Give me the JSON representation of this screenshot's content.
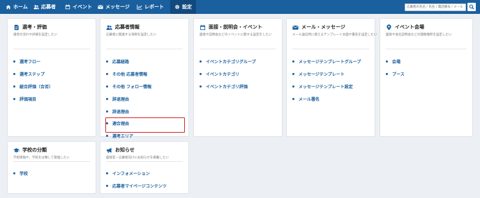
{
  "nav": {
    "items": [
      {
        "label": "ホーム",
        "icon": "home-icon"
      },
      {
        "label": "応募者",
        "icon": "users-icon"
      },
      {
        "label": "イベント",
        "icon": "calendar-icon"
      },
      {
        "label": "メッセージ",
        "icon": "mail-icon"
      },
      {
        "label": "レポート",
        "icon": "chart-icon"
      },
      {
        "label": "設定",
        "icon": "gear-icon",
        "active": true
      }
    ],
    "search_placeholder": "応募者の氏名 / 氏名 / 電話番号 / メール"
  },
  "cards": [
    {
      "title": "選考・評価",
      "icon": "document-icon",
      "description": "選考の流れや評価を設定したい",
      "links": [
        "選考フロー",
        "選考ステップ",
        "総合評価（合否）",
        "評価項目"
      ]
    },
    {
      "title": "応募者情報",
      "icon": "users-icon",
      "description": "応募者に関連する項目を設定したい",
      "links": [
        "応募経路",
        "その他 応募者情報",
        "その他 フォロー情報",
        "辞退理由",
        "辞退理由",
        "適合理由",
        "選考エリア"
      ]
    },
    {
      "title": "面接・説明会・イベント",
      "icon": "calendar-icon",
      "description": "面接や説明会などのイベントに関する設定をしたい",
      "links": [
        "イベントカテゴリグループ",
        "イベントカテゴリ",
        "イベントカテゴリ評価"
      ]
    },
    {
      "title": "メール・メッセージ",
      "icon": "mail-icon",
      "description": "メール送信時に使えるテンプレート文面や署名を設定したい",
      "links": [
        "メッセージテンプレートグループ",
        "メッセージテンプレート",
        "メッセージテンプレート設定",
        "メール署名"
      ]
    },
    {
      "title": "イベント会場",
      "icon": "map-marker-icon",
      "description": "面接や会社説明会などの開催場所を設定したい",
      "links": [
        "会場",
        "ブース"
      ]
    },
    {
      "title": "学校の分類",
      "icon": "graduation-icon",
      "description": "学校情報や、学校を分類して管理したい",
      "links": [
        "学校"
      ]
    },
    {
      "title": "お知らせ",
      "icon": "megaphone-icon",
      "description": "面接官・応募者向けにお知らせを掲載したい",
      "links": [
        "インフォメーション",
        "応募者マイページコンテンツ"
      ]
    }
  ],
  "highlighted_link": "選考エリア",
  "colors": {
    "nav_bg": "#1a5f9e",
    "nav_active_bg": "#124a7e",
    "link": "#1a5f9e",
    "highlight": "#d62828",
    "page_bg": "#eceff3"
  }
}
